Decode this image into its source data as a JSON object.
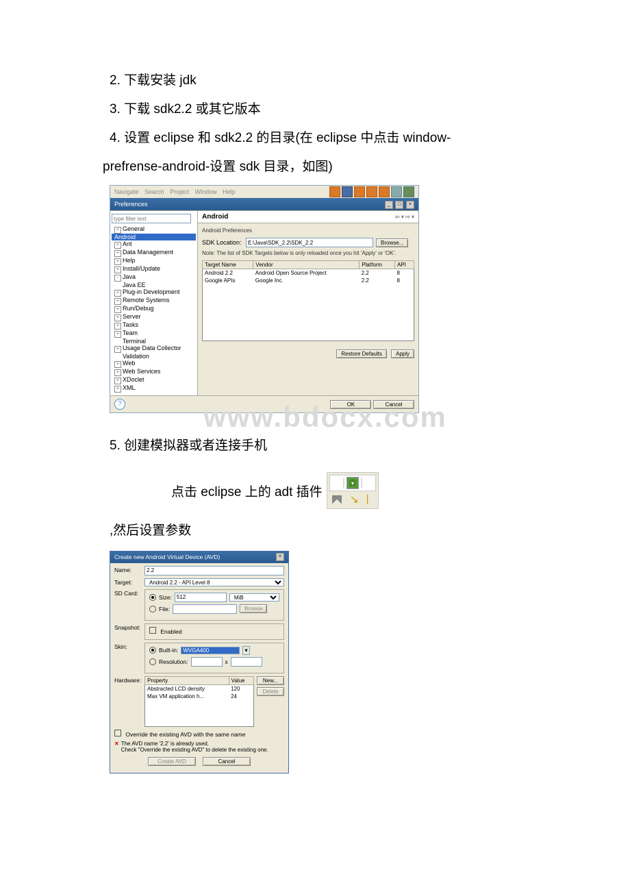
{
  "text": {
    "p2": "2. 下载安装 jdk",
    "p3": "3. 下载 sdk2.2 或其它版本",
    "p4a": "4. 设置 eclipse 和 sdk2.2 的目录(在 eclipse 中点击 window-",
    "p4b": "prefrense-android-设置 sdk 目录，如图)",
    "p5": "5. 创建模拟器或者连接手机",
    "p6a": "点击 eclipse 上的 adt 插件",
    "p7": ",然后设置参数"
  },
  "watermark": "www.bdocx.com",
  "prefs": {
    "menu": [
      "Navigate",
      "Search",
      "Project",
      "Window",
      "Help"
    ],
    "title": "Preferences",
    "filter_placeholder": "type filter text",
    "tree": [
      {
        "label": "General",
        "pm": "+"
      },
      {
        "label": "Android",
        "sel": true
      },
      {
        "label": "Ant",
        "pm": "+"
      },
      {
        "label": "Data Management",
        "pm": "+"
      },
      {
        "label": "Help",
        "pm": "+"
      },
      {
        "label": "Install/Update",
        "pm": "+"
      },
      {
        "label": "Java",
        "pm": "-"
      },
      {
        "label": "Java EE",
        "child": true
      },
      {
        "label": "Plug-in Development",
        "pm": "+"
      },
      {
        "label": "Remote Systems",
        "pm": "+"
      },
      {
        "label": "Run/Debug",
        "pm": "+"
      },
      {
        "label": "Server",
        "pm": "+"
      },
      {
        "label": "Tasks",
        "pm": "+"
      },
      {
        "label": "Team",
        "pm": "+"
      },
      {
        "label": "Terminal",
        "child": true
      },
      {
        "label": "Usage Data Collector",
        "pm": "+"
      },
      {
        "label": "Validation",
        "child": true
      },
      {
        "label": "Web",
        "pm": "+"
      },
      {
        "label": "Web Services",
        "pm": "+"
      },
      {
        "label": "XDoclet",
        "pm": "+"
      },
      {
        "label": "XML",
        "pm": "+"
      }
    ],
    "section_title": "Android",
    "pref_heading": "Android Preferences",
    "sdk_label": "SDK Location:",
    "sdk_value": "E:\\Java\\SDK_2.2\\SDK_2.2",
    "browse": "Browse...",
    "note": "Note: The list of SDK Targets below is only reloaded once you hit 'Apply' or 'OK'.",
    "cols": [
      "Target Name",
      "Vendor",
      "Platform",
      "API"
    ],
    "rows": [
      [
        "Android 2.2",
        "Android Open Source Project",
        "2.2",
        "8"
      ],
      [
        "Google APIs",
        "Google Inc.",
        "2.2",
        "8"
      ]
    ],
    "restore": "Restore Defaults",
    "apply": "Apply",
    "ok": "OK",
    "cancel": "Cancel"
  },
  "avd": {
    "title": "Create new Android Virtual Device (AVD)",
    "name_label": "Name:",
    "name_value": "2.2",
    "target_label": "Target:",
    "target_value": "Android 2.2 - API Level 8",
    "sdcard_label": "SD Card:",
    "size_label": "Size:",
    "size_value": "512",
    "size_unit": "MiB",
    "file_label": "File:",
    "file_browse": "Browse...",
    "snapshot_label": "Snapshot:",
    "enabled": "Enabled",
    "skin_label": "Skin:",
    "builtin": "Built-in:",
    "builtin_value": "WVGA400",
    "resolution": "Resolution:",
    "res_x": "x",
    "hardware_label": "Hardware:",
    "hw_cols": [
      "Property",
      "Value"
    ],
    "hw_rows": [
      [
        "Abstracted LCD density",
        "120"
      ],
      [
        "Max VM application h...",
        "24"
      ]
    ],
    "new": "New...",
    "delete": "Delete",
    "override": "Override the existing AVD with the same name",
    "err1": "The AVD name '2.2' is already used.",
    "err2": "Check \"Override the existing AVD\" to delete the existing one.",
    "create": "Create AVD",
    "cancel": "Cancel"
  }
}
